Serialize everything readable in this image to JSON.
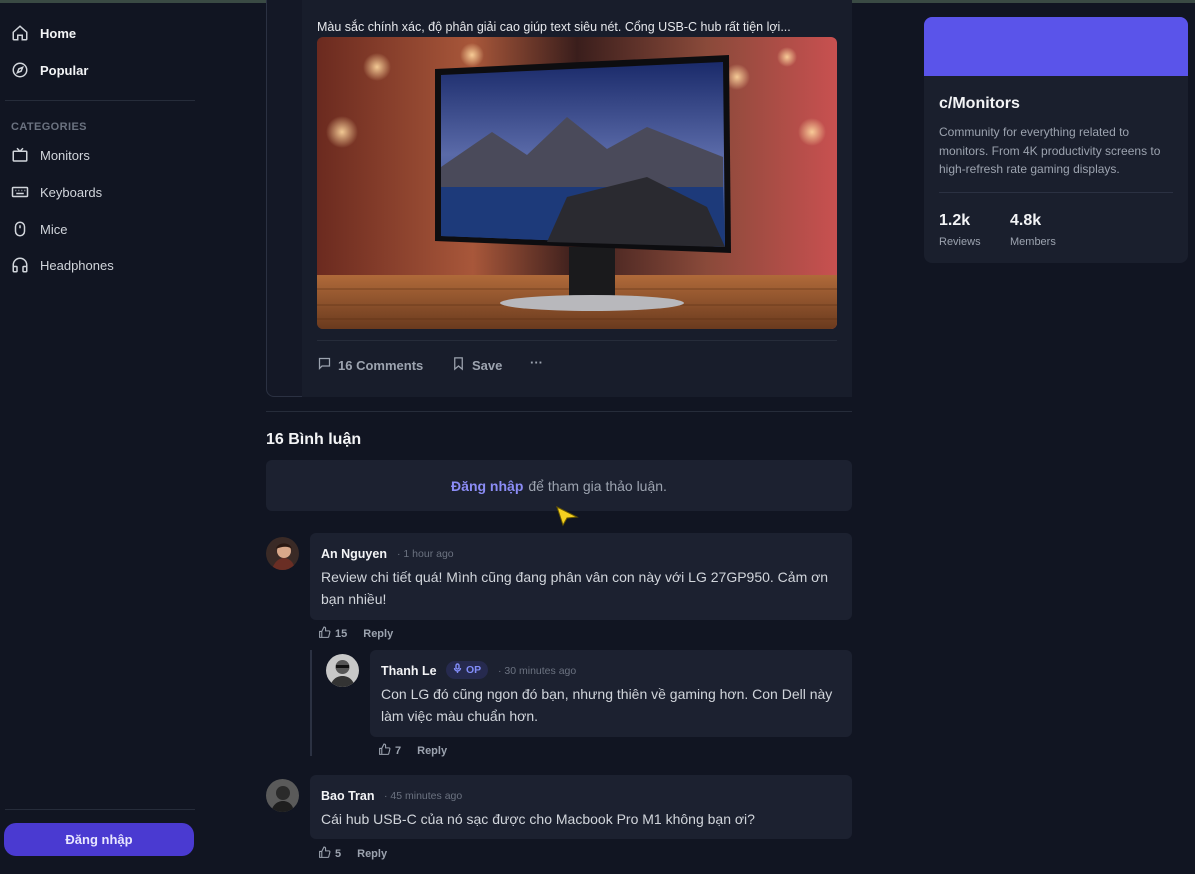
{
  "sidebar": {
    "nav": [
      {
        "label": "Home",
        "icon": "home-icon"
      },
      {
        "label": "Popular",
        "icon": "compass-icon"
      }
    ],
    "categories_title": "CATEGORIES",
    "categories": [
      {
        "label": "Monitors",
        "icon": "tv-icon"
      },
      {
        "label": "Keyboards",
        "icon": "keyboard-icon"
      },
      {
        "label": "Mice",
        "icon": "mouse-icon"
      },
      {
        "label": "Headphones",
        "icon": "headphones-icon"
      }
    ],
    "login_label": "Đăng nhập"
  },
  "post": {
    "text": "Màu sắc chính xác, độ phân giải cao giúp text siêu nét. Cổng USB-C hub rất tiện lợi...",
    "image": "monitor-product-photo",
    "actions": {
      "comments": "16 Comments",
      "save": "Save",
      "more": "···"
    }
  },
  "comments_section": {
    "title": "16 Bình luận",
    "login_link": "Đăng nhập",
    "login_rest": "để tham gia thảo luận."
  },
  "comments": [
    {
      "author": "An Nguyen",
      "time": "· 1 hour ago",
      "text": "Review chi tiết quá! Mình cũng đang phân vân con này với LG 27GP950. Cảm ơn bạn nhiều!",
      "likes": "15",
      "reply": "Reply"
    },
    {
      "author": "Thanh Le",
      "badge": "OP",
      "time": "· 30 minutes ago",
      "text": "Con LG đó cũng ngon đó bạn, nhưng thiên về gaming hơn. Con Dell này làm việc màu chuẩn hơn.",
      "likes": "7",
      "reply": "Reply"
    },
    {
      "author": "Bao Tran",
      "time": "· 45 minutes ago",
      "text": "Cái hub USB-C của nó sạc được cho Macbook Pro M1 không bạn ơi?",
      "likes": "5",
      "reply": "Reply"
    }
  ],
  "community": {
    "name": "c/Monitors",
    "description": "Community for everything related to monitors. From 4K productivity screens to high-refresh rate gaming displays.",
    "stats": [
      {
        "value": "1.2k",
        "label": "Reviews"
      },
      {
        "value": "4.8k",
        "label": "Members"
      }
    ],
    "banner_color": "#5a54ea"
  }
}
